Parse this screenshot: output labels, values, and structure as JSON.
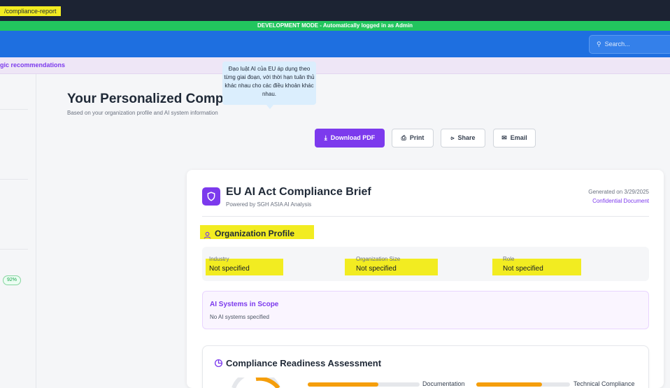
{
  "url_path": "/compliance-report",
  "dev_banner": "DEVELOPMENT MODE - Automatically logged in as Admin",
  "search": {
    "placeholder": "Search..."
  },
  "strip_text": "gic recommendations",
  "tooltip": "Đạo luật AI của EU áp dụng theo từng giai đoạn, với thời hạn tuân thủ khác nhau cho các điều khoản khác nhau.",
  "sidebar": {
    "percent_badge": "92%"
  },
  "page": {
    "title": "Your Personalized Compl",
    "subtitle": "Based on your organization profile and AI system information"
  },
  "actions": {
    "download_pdf": "Download PDF",
    "print": "Print",
    "share": "Share",
    "email": "Email"
  },
  "brief": {
    "title": "EU AI Act Compliance Brief",
    "powered_by": "Powered by SGH ASIA AI Analysis",
    "generated": "Generated on 3/29/2025",
    "confidential": "Confidential Document"
  },
  "org_profile": {
    "title": "Organization Profile",
    "fields": [
      {
        "label": "Industry",
        "value": "Not specified"
      },
      {
        "label": "Organization Size",
        "value": "Not specified"
      },
      {
        "label": "Role",
        "value": "Not specified"
      }
    ]
  },
  "ai_systems": {
    "title": "AI Systems in Scope",
    "empty_text": "No AI systems specified"
  },
  "readiness": {
    "title": "Compliance Readiness Assessment",
    "bars": [
      {
        "label": "Documentation",
        "fill_fraction": 0.63
      },
      {
        "label": "Technical Compliance",
        "fill_fraction": 0.7
      }
    ]
  },
  "colors": {
    "accent": "#7c3aed",
    "topbar": "#1e6fe0",
    "dev_banner": "#22c55e",
    "highlight": "#f2ec21",
    "progress": "#f59e0b"
  }
}
